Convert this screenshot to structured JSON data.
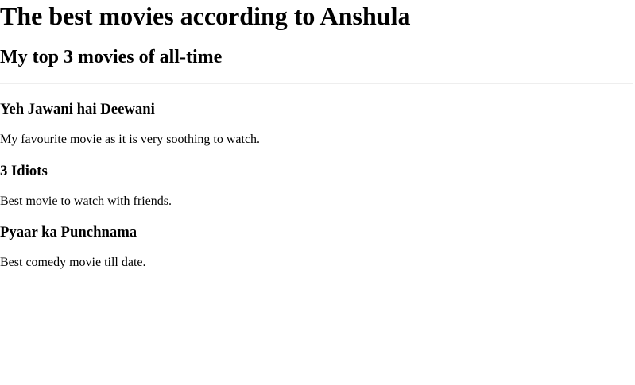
{
  "page": {
    "title": "The best movies according to Anshula",
    "subtitle": "My top 3 movies of all-time"
  },
  "movies": [
    {
      "name": "Yeh Jawani hai Deewani",
      "description": "My favourite movie as it is very soothing to watch."
    },
    {
      "name": "3 Idiots",
      "description": "Best movie to watch with friends."
    },
    {
      "name": "Pyaar ka Punchnama",
      "description": "Best comedy movie till date."
    }
  ]
}
